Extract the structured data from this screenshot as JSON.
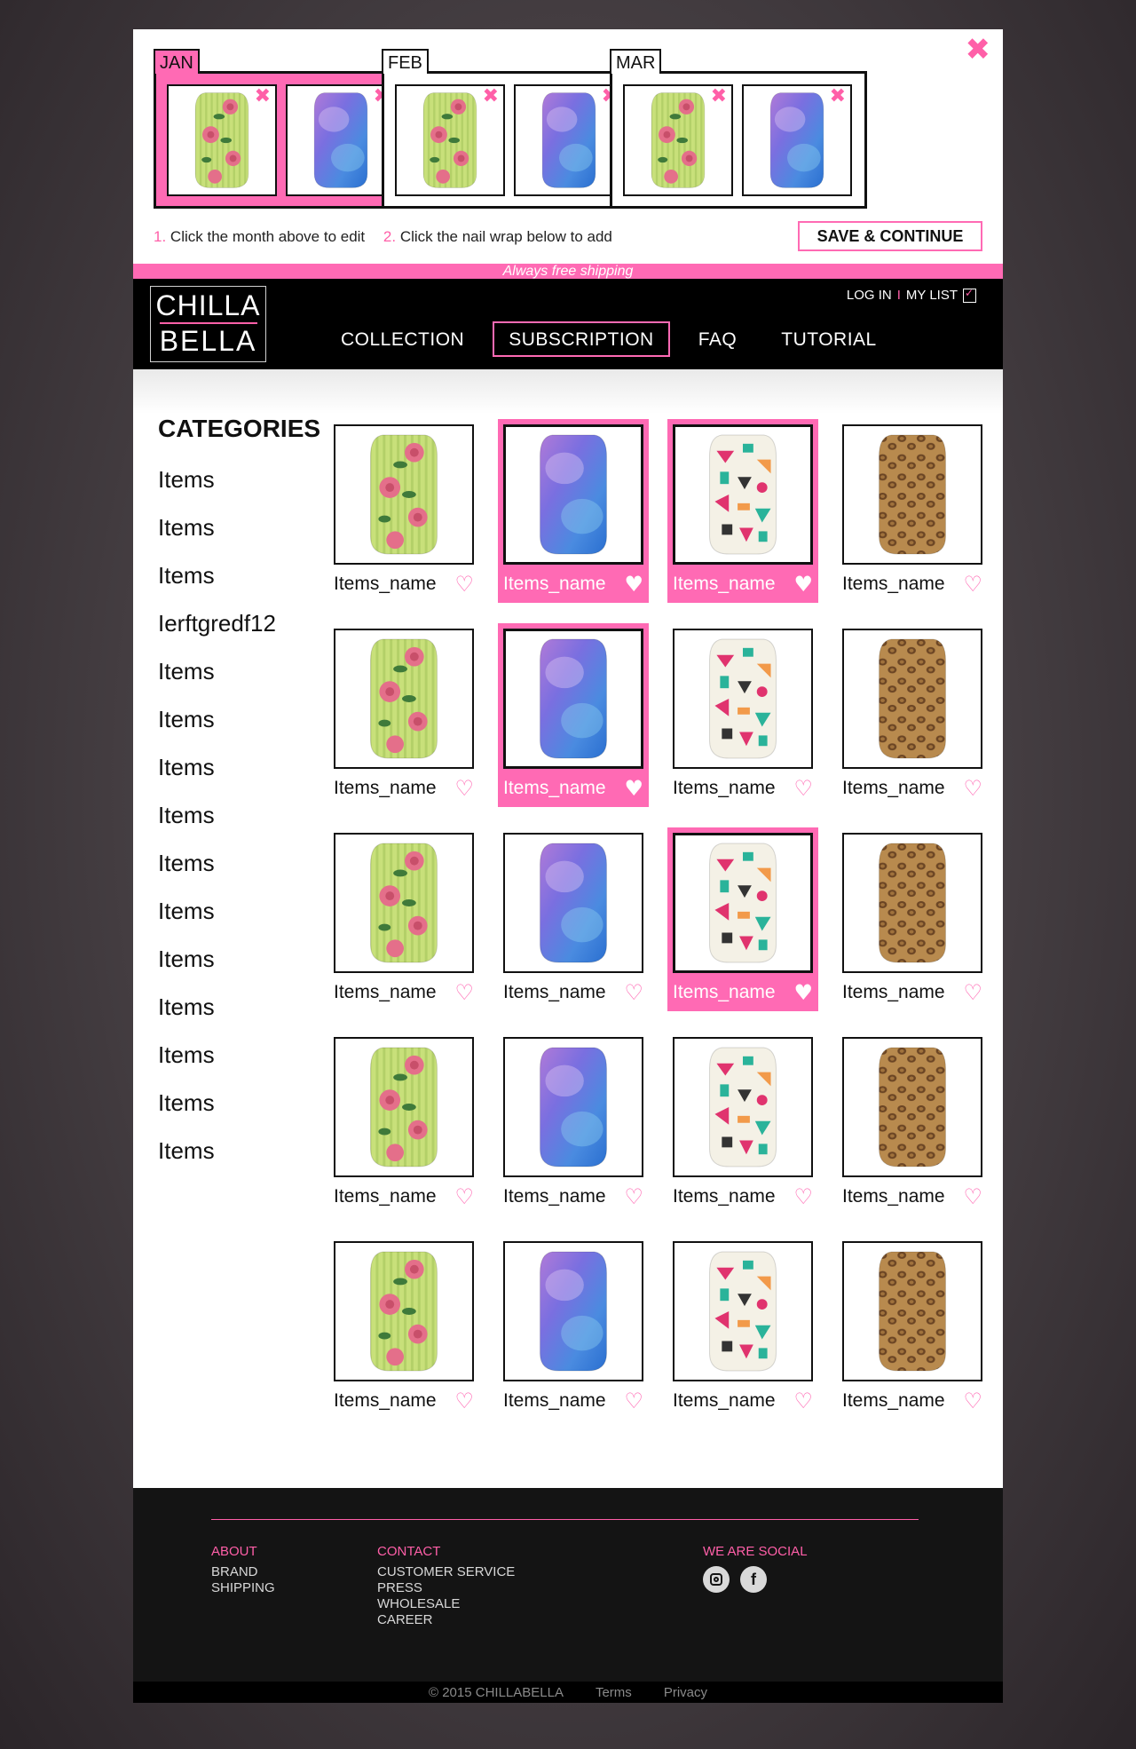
{
  "planner": {
    "close_glyph": "✖",
    "remove_glyph": "✖",
    "months": [
      {
        "label": "JAN",
        "active": true,
        "slots": [
          "rose",
          "watercolor"
        ]
      },
      {
        "label": "FEB",
        "active": false,
        "slots": [
          "rose",
          "watercolor"
        ]
      },
      {
        "label": "MAR",
        "active": false,
        "slots": [
          "rose",
          "watercolor"
        ]
      }
    ],
    "step1_num": "1.",
    "step1_text": "Click the month above to edit",
    "step2_num": "2.",
    "step2_text": "Click the nail wrap below to add",
    "save_label": "SAVE & CONTINUE"
  },
  "shipping_text": "Always free shipping",
  "nav": {
    "logo_line1": "CHILLA",
    "logo_line2": "BELLA",
    "login": "LOG IN",
    "separator": "I",
    "mylist": "MY LIST",
    "links": [
      {
        "label": "COLLECTION",
        "active": false
      },
      {
        "label": "SUBSCRIPTION",
        "active": true
      },
      {
        "label": "FAQ",
        "active": false
      },
      {
        "label": "TUTORIAL",
        "active": false
      }
    ]
  },
  "sidebar": {
    "title": "CATEGORIES",
    "items": [
      "Items",
      "Items",
      "Items",
      "Ierftgredf12",
      "Items",
      "Items",
      "Items",
      "Items",
      "Items",
      "Items",
      "Items",
      "Items",
      "Items",
      "Items",
      "Items"
    ]
  },
  "products": {
    "heart_outline": "♡",
    "heart_filled": "♥",
    "items": [
      {
        "name": "Items_name",
        "pattern": "rose",
        "selected": false
      },
      {
        "name": "Items_name",
        "pattern": "watercolor",
        "selected": true
      },
      {
        "name": "Items_name",
        "pattern": "geometric",
        "selected": true
      },
      {
        "name": "Items_name",
        "pattern": "leopard",
        "selected": false
      },
      {
        "name": "Items_name",
        "pattern": "rose",
        "selected": false
      },
      {
        "name": "Items_name",
        "pattern": "watercolor",
        "selected": true
      },
      {
        "name": "Items_name",
        "pattern": "geometric",
        "selected": false
      },
      {
        "name": "Items_name",
        "pattern": "leopard",
        "selected": false
      },
      {
        "name": "Items_name",
        "pattern": "rose",
        "selected": false
      },
      {
        "name": "Items_name",
        "pattern": "watercolor",
        "selected": false
      },
      {
        "name": "Items_name",
        "pattern": "geometric",
        "selected": true
      },
      {
        "name": "Items_name",
        "pattern": "leopard",
        "selected": false
      },
      {
        "name": "Items_name",
        "pattern": "rose",
        "selected": false
      },
      {
        "name": "Items_name",
        "pattern": "watercolor",
        "selected": false
      },
      {
        "name": "Items_name",
        "pattern": "geometric",
        "selected": false
      },
      {
        "name": "Items_name",
        "pattern": "leopard",
        "selected": false
      },
      {
        "name": "Items_name",
        "pattern": "rose",
        "selected": false
      },
      {
        "name": "Items_name",
        "pattern": "watercolor",
        "selected": false
      },
      {
        "name": "Items_name",
        "pattern": "geometric",
        "selected": false
      },
      {
        "name": "Items_name",
        "pattern": "leopard",
        "selected": false
      }
    ]
  },
  "footer": {
    "about": {
      "title": "ABOUT",
      "links": [
        "BRAND",
        "SHIPPING"
      ]
    },
    "contact": {
      "title": "CONTACT",
      "links": [
        "CUSTOMER SERVICE",
        "PRESS",
        "WHOLESALE",
        "CAREER"
      ]
    },
    "social": {
      "title": "WE ARE SOCIAL",
      "icons": [
        "instagram-icon",
        "facebook-icon"
      ],
      "facebook_glyph": "f"
    },
    "copyright": "© 2015 CHILLABELLA",
    "terms": "Terms",
    "privacy": "Privacy"
  },
  "colors": {
    "accent": "#ff6ab4",
    "nav_bg": "#000000",
    "footer_bg": "#141414"
  }
}
